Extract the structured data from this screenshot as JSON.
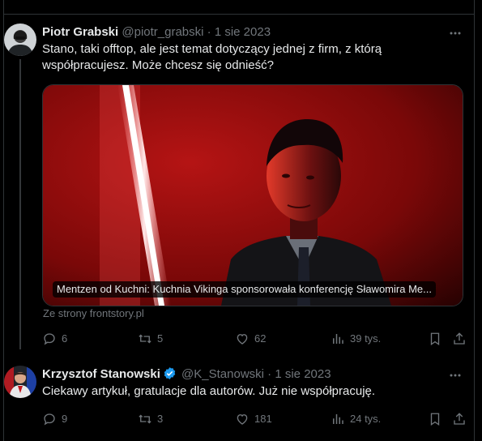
{
  "tweets": [
    {
      "author_name": "Piotr Grabski",
      "handle": "@piotr_grabski",
      "date": "1 sie 2023",
      "separator": "·",
      "text": "Stano, taki offtop, ale jest temat dotyczący jednej z firm, z którą współpracujesz. Może chcesz się odnieść?",
      "card": {
        "caption": "Mentzen od Kuchni: Kuchnia Vikinga sponsorowała konferencję Sławomira Me...",
        "source": "Ze strony frontstory.pl"
      },
      "stats": {
        "replies": "6",
        "reposts": "5",
        "likes": "62",
        "views": "39 tys."
      }
    },
    {
      "author_name": "Krzysztof Stanowski",
      "handle": "@K_Stanowski",
      "date": "1 sie 2023",
      "separator": "·",
      "text": "Ciekawy artykuł, gratulacje dla autorów. Już nie współpracuję.",
      "stats": {
        "replies": "9",
        "reposts": "3",
        "likes": "181",
        "views": "24 tys."
      }
    }
  ],
  "icons": {
    "more": "more-icon",
    "verified": "verified-badge-icon",
    "reply": "reply-icon",
    "repost": "repost-icon",
    "like": "like-icon",
    "views": "views-icon",
    "bookmark": "bookmark-icon",
    "share": "share-icon"
  },
  "colors": {
    "background": "#000000",
    "text": "#e7e9ea",
    "muted": "#71767b",
    "border": "#2f3336",
    "verified": "#1d9bf0"
  }
}
